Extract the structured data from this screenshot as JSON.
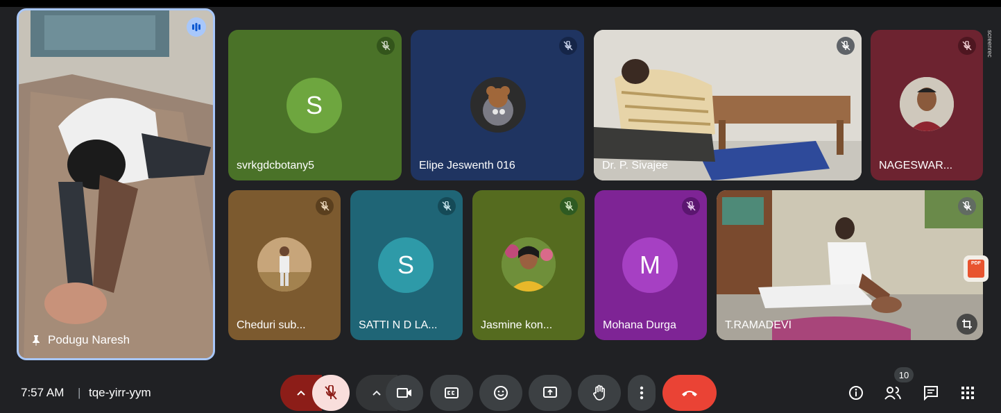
{
  "tiles": {
    "pinned": {
      "name": "Podugu Naresh"
    },
    "t1": {
      "name": "svrkgdcbotany5",
      "initial": "S"
    },
    "t2": {
      "name": "Elipe Jeswenth 016"
    },
    "t3": {
      "name": "Dr. P. Sivajee"
    },
    "t4": {
      "name": "NAGESWAR..."
    },
    "t5": {
      "name": "Cheduri sub..."
    },
    "t6": {
      "name": "SATTI N D LA...",
      "initial": "S"
    },
    "t7": {
      "name": "Jasmine kon..."
    },
    "t8": {
      "name": "Mohana Durga",
      "initial": "M"
    },
    "t9": {
      "name": "T.RAMADEVI"
    }
  },
  "bottom": {
    "time": "7:57 AM",
    "separator": "|",
    "meeting_code": "tqe-yirr-yym",
    "people_count": "10"
  },
  "watermark": "screenrec",
  "pdf_label": "PDF",
  "icons": {
    "pin": "pin-icon",
    "speaking": "audio-level-icon",
    "mic_off": "mic-off-icon",
    "camera": "videocam-icon",
    "captions": "closed-caption-icon",
    "emoji": "emoji-icon",
    "present": "present-screen-icon",
    "hand": "raise-hand-icon",
    "more": "more-vert-icon",
    "end_call": "call-end-icon",
    "info": "info-icon",
    "people": "people-icon",
    "chat": "chat-icon",
    "apps": "apps-grid-icon",
    "crop": "crop-icon"
  },
  "colors": {
    "end_call": "#ea4335",
    "mic_off_bg": "#f9dedc",
    "mic_toggle_bg": "#8c1d18",
    "pinned_border": "#a8c7fa"
  }
}
